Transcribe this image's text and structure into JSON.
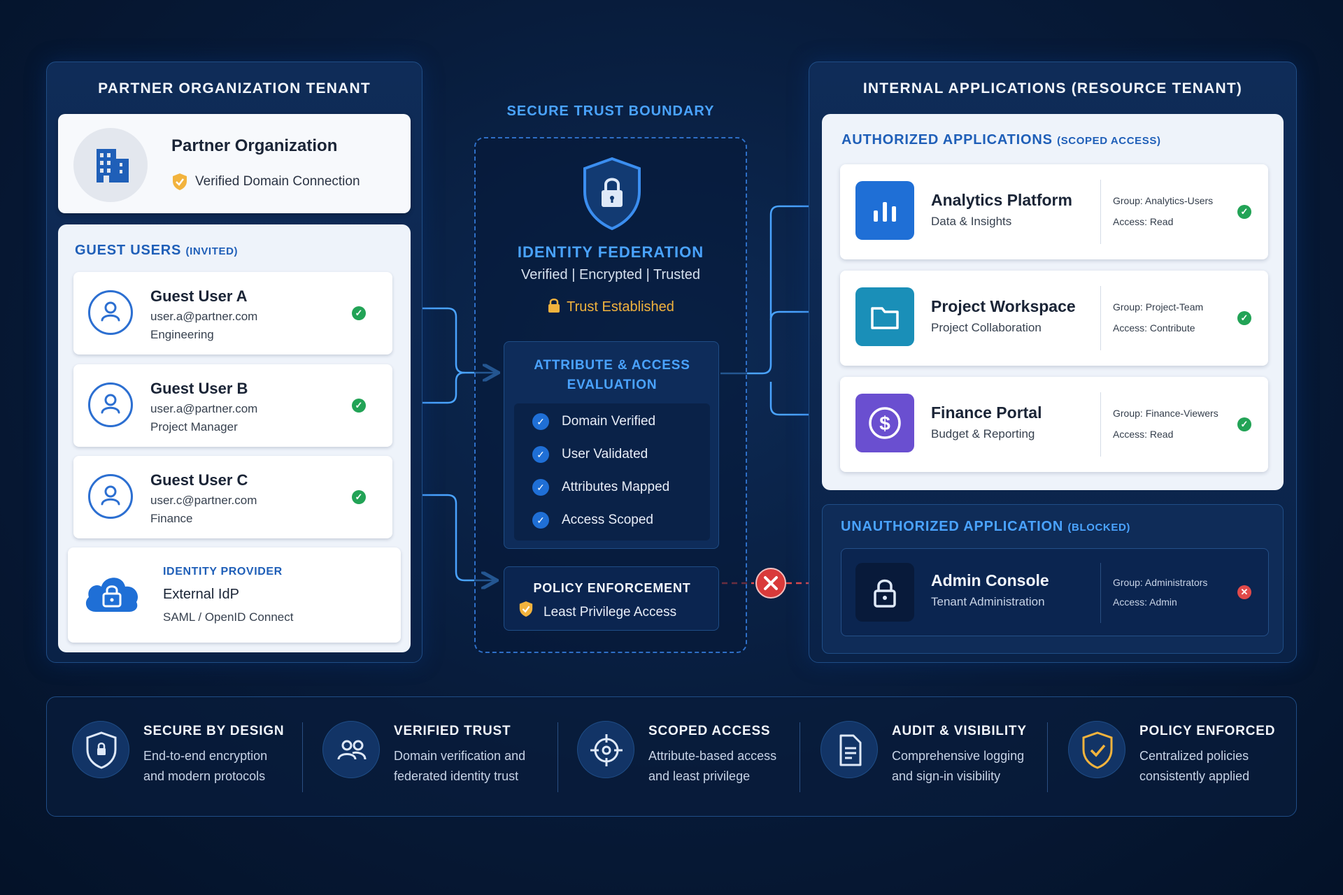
{
  "partner_tenant": {
    "title": "PARTNER ORGANIZATION TENANT",
    "org_name": "Partner Organization",
    "org_status": "Verified Domain Connection",
    "guest_users": {
      "title": "GUEST USERS",
      "title_suffix": "(INVITED)",
      "users": [
        {
          "name": "Guest User A",
          "email": "user.a@partner.com",
          "role": "Engineering"
        },
        {
          "name": "Guest User B",
          "email": "user.a@partner.com",
          "role": "Project Manager"
        },
        {
          "name": "Guest User C",
          "email": "user.c@partner.com",
          "role": "Finance"
        }
      ],
      "idp": {
        "label": "IDENTITY PROVIDER",
        "name": "External IdP",
        "protocols": "SAML / OpenID Connect"
      }
    }
  },
  "boundary": {
    "title": "SECURE TRUST BOUNDARY",
    "federation_title": "IDENTITY FEDERATION",
    "federation_sub": "Verified | Encrypted | Trusted",
    "trust_status": "Trust Established",
    "evaluation": {
      "title_line1": "ATTRIBUTE & ACCESS",
      "title_line2": "EVALUATION",
      "checks": [
        "Domain Verified",
        "User Validated",
        "Attributes Mapped",
        "Access Scoped"
      ]
    },
    "policy": {
      "title": "POLICY ENFORCEMENT",
      "subtitle": "Least Privilege Access"
    }
  },
  "resource_tenant": {
    "title": "INTERNAL APPLICATIONS (RESOURCE TENANT)",
    "authorized": {
      "title": "AUTHORIZED APPLICATIONS",
      "title_suffix": "(SCOPED ACCESS)",
      "apps": [
        {
          "name": "Analytics Platform",
          "sub": "Data & Insights",
          "group": "Group: Analytics-Users",
          "access": "Access: Read",
          "icon": "bar-chart-icon",
          "color": "#1f6fd6"
        },
        {
          "name": "Project Workspace",
          "sub": "Project Collaboration",
          "group": "Group: Project-Team",
          "access": "Access: Contribute",
          "icon": "folder-icon",
          "color": "#1a8fb8"
        },
        {
          "name": "Finance Portal",
          "sub": "Budget & Reporting",
          "group": "Group: Finance-Viewers",
          "access": "Access: Read",
          "icon": "dollar-icon",
          "color": "#6a4fd0"
        }
      ]
    },
    "unauthorized": {
      "title": "UNAUTHORIZED APPLICATION",
      "title_suffix": "(BLOCKED)",
      "app": {
        "name": "Admin Console",
        "sub": "Tenant Administration",
        "group": "Group: Administrators",
        "access": "Access: Admin",
        "icon": "lock-icon"
      }
    }
  },
  "features": [
    {
      "title": "SECURE BY DESIGN",
      "line1": "End-to-end encryption",
      "line2": "and modern protocols",
      "icon": "shield-lock-icon"
    },
    {
      "title": "VERIFIED TRUST",
      "line1": "Domain verification and",
      "line2": "federated identity trust",
      "icon": "users-icon"
    },
    {
      "title": "SCOPED ACCESS",
      "line1": "Attribute-based access",
      "line2": "and least privilege",
      "icon": "target-icon"
    },
    {
      "title": "AUDIT & VISIBILITY",
      "line1": "Comprehensive logging",
      "line2": "and sign-in visibility",
      "icon": "document-icon"
    },
    {
      "title": "POLICY ENFORCED",
      "line1": "Centralized policies",
      "line2": "consistently applied",
      "icon": "shield-check-icon"
    }
  ],
  "colors": {
    "accent": "#4aa3ff",
    "success": "#22a356",
    "blocked": "#e24a4a",
    "warning": "#f2b33d"
  }
}
